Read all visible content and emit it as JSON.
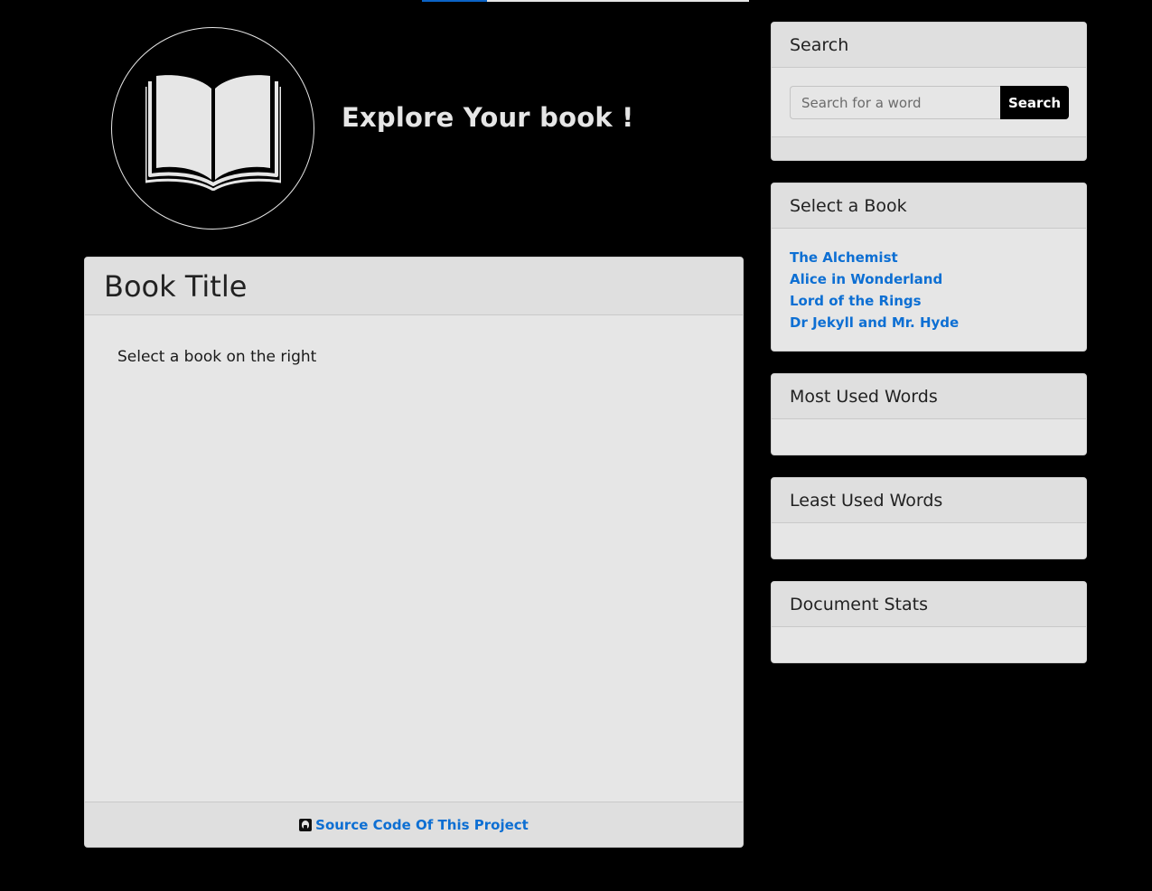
{
  "header": {
    "title": "Explore Your book !",
    "progress_fraction": 0.2
  },
  "main": {
    "title": "Book Title",
    "body_text": "Select a book on the right",
    "footer_link": "Source Code Of This Project"
  },
  "sidebar": {
    "search": {
      "title": "Search",
      "placeholder": "Search for a word",
      "button_label": "Search"
    },
    "select_book": {
      "title": "Select a Book",
      "books": [
        "The Alchemist",
        "Alice in Wonderland",
        "Lord of the Rings",
        "Dr Jekyll and Mr. Hyde"
      ]
    },
    "most_used": {
      "title": "Most Used Words"
    },
    "least_used": {
      "title": "Least Used Words"
    },
    "stats": {
      "title": "Document Stats"
    }
  },
  "colors": {
    "background": "#000000",
    "panel": "#e6e6e6",
    "link": "#0d6fd3",
    "progress": "#0b63c6"
  },
  "icons": {
    "logo": "open-book-icon",
    "footer": "github-icon"
  }
}
